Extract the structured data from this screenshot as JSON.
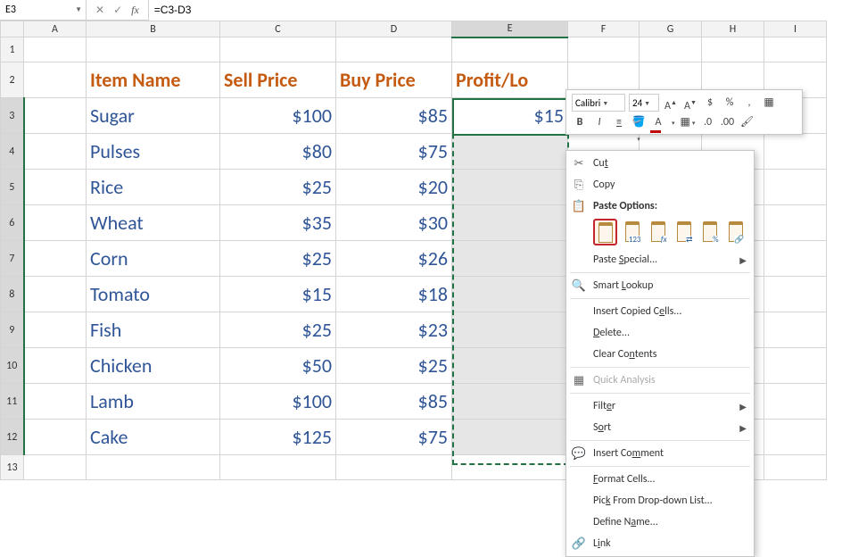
{
  "nameBox": "E3",
  "formula": "=C3-D3",
  "columns": [
    "A",
    "B",
    "C",
    "D",
    "E",
    "F",
    "G",
    "H",
    "I"
  ],
  "rowNumbers": [
    1,
    2,
    3,
    4,
    5,
    6,
    7,
    8,
    9,
    10,
    11,
    12,
    13
  ],
  "headers": {
    "B": "Item Name",
    "C": "Sell Price",
    "D": "Buy Price",
    "E": "Profit/Lo"
  },
  "data": [
    {
      "item": "Sugar",
      "sell": "$100",
      "buy": "$85",
      "pl": "$15"
    },
    {
      "item": "Pulses",
      "sell": "$80",
      "buy": "$75",
      "pl": ""
    },
    {
      "item": "Rice",
      "sell": "$25",
      "buy": "$20",
      "pl": ""
    },
    {
      "item": "Wheat",
      "sell": "$35",
      "buy": "$30",
      "pl": ""
    },
    {
      "item": "Corn",
      "sell": "$25",
      "buy": "$26",
      "pl": ""
    },
    {
      "item": "Tomato",
      "sell": "$15",
      "buy": "$18",
      "pl": ""
    },
    {
      "item": "Fish",
      "sell": "$25",
      "buy": "$23",
      "pl": ""
    },
    {
      "item": "Chicken",
      "sell": "$50",
      "buy": "$25",
      "pl": ""
    },
    {
      "item": "Lamb",
      "sell": "$100",
      "buy": "$85",
      "pl": ""
    },
    {
      "item": "Cake",
      "sell": "$125",
      "buy": "$75",
      "pl": ""
    }
  ],
  "miniToolbar": {
    "font": "Calibri",
    "size": "24",
    "buttons": [
      "A▲",
      "A▼",
      "$",
      "%",
      ",",
      "▦"
    ],
    "row2": [
      "B",
      "I",
      "≣",
      "🖉",
      "A"
    ]
  },
  "contextMenu": {
    "cut": "Cut",
    "copy": "Copy",
    "pasteHeader": "Paste Options:",
    "pasteSpecial": "Paste Special...",
    "smartLookup": "Smart Lookup",
    "insertCopied": "Insert Copied Cells...",
    "delete": "Delete...",
    "clearContents": "Clear Contents",
    "quickAnalysis": "Quick Analysis",
    "filter": "Filter",
    "sort": "Sort",
    "insertComment": "Insert Comment",
    "formatCells": "Format Cells...",
    "pickDropdown": "Pick From Drop-down List...",
    "defineName": "Define Name...",
    "link": "Link"
  },
  "pasteIconLabels": [
    "paste",
    "123",
    "fx",
    "fmt",
    "%",
    "link"
  ]
}
